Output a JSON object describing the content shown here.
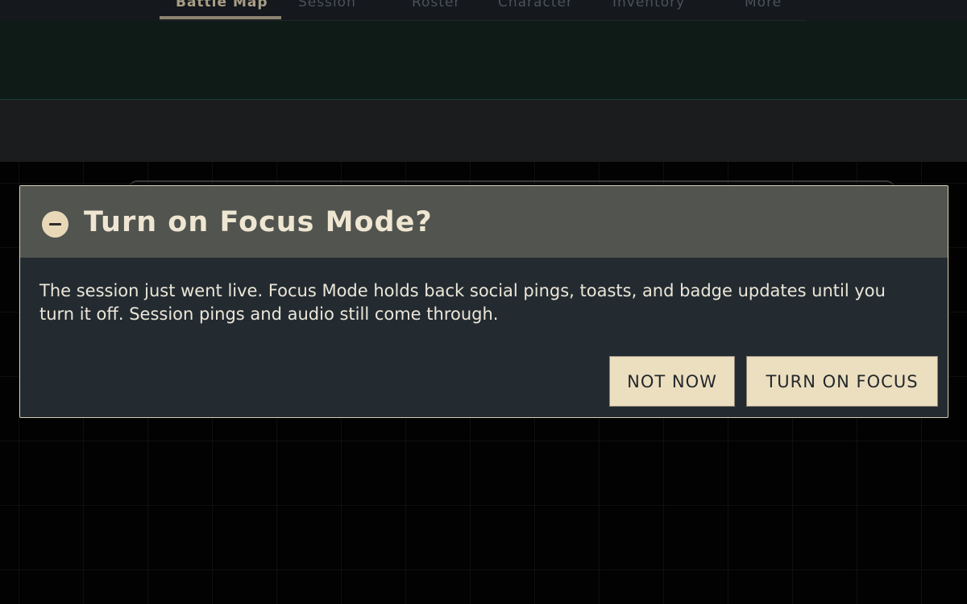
{
  "nav": {
    "tabs": [
      {
        "label": "Battle Map",
        "active": true
      },
      {
        "label": "Session",
        "active": false
      },
      {
        "label": "Roster",
        "active": false
      },
      {
        "label": "Character",
        "active": false
      },
      {
        "label": "Inventory",
        "active": false
      },
      {
        "label": "More",
        "active": false
      }
    ]
  },
  "dialog": {
    "icon": "minus-circle-icon",
    "title": "Turn on Focus Mode?",
    "body": "The session just went live. Focus Mode holds back social pings, toasts, and badge updates until you turn it off. Session pings and audio still come through.",
    "secondary_button": "NOT NOW",
    "primary_button": "TURN ON FOCUS"
  },
  "colors": {
    "accent": "#ecdfc0",
    "dialog_border": "#d8ccb1",
    "dialog_header": "#51544f",
    "dialog_body": "#232b31",
    "app_background": "#000000"
  }
}
